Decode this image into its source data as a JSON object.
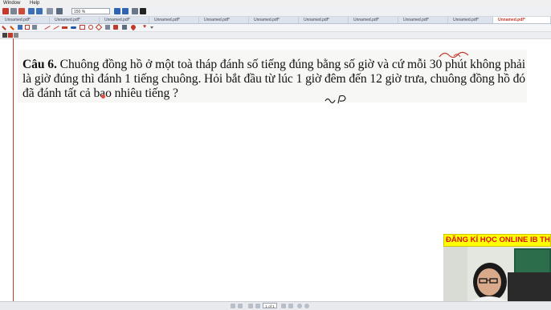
{
  "menu": {
    "items": [
      "Window",
      "Help"
    ]
  },
  "toolbar": {
    "zoom_value": "150 %"
  },
  "tabs": [
    {
      "label": "Unnamed.pdf*"
    },
    {
      "label": "Unnamed.pdf*"
    },
    {
      "label": "Unnamed.pdf*"
    },
    {
      "label": "Unnamed.pdf*"
    },
    {
      "label": "Unnamed.pdf*"
    },
    {
      "label": "Unnamed.pdf*"
    },
    {
      "label": "Unnamed.pdf*"
    },
    {
      "label": "Unnamed.pdf*"
    },
    {
      "label": "Unnamed.pdf*"
    },
    {
      "label": "Unnamed.pdf*"
    },
    {
      "label": "Unnamed.pdf*"
    }
  ],
  "document": {
    "question_label": "Câu 6.",
    "question_text": "Chuông đồng hồ ở một toà tháp đánh số tiếng đúng bằng số giờ và cứ mỗi 30 phút không phải là giờ đúng thì đánh 1 tiếng chuông. Hỏi bắt đầu từ lúc 1 giờ đêm đến 12 giờ trưa, chuông đồng hồ đó đã đánh tất cả bao nhiêu tiếng ?"
  },
  "overlay": {
    "banner_text": "ĐĂNG KÍ HỌC ONLINE IB THẦY"
  },
  "status": {
    "page_indicator": "1 of 1"
  },
  "colors": {
    "accent_red": "#c0392b",
    "banner_bg": "#ffff00",
    "banner_text": "#e01010"
  }
}
